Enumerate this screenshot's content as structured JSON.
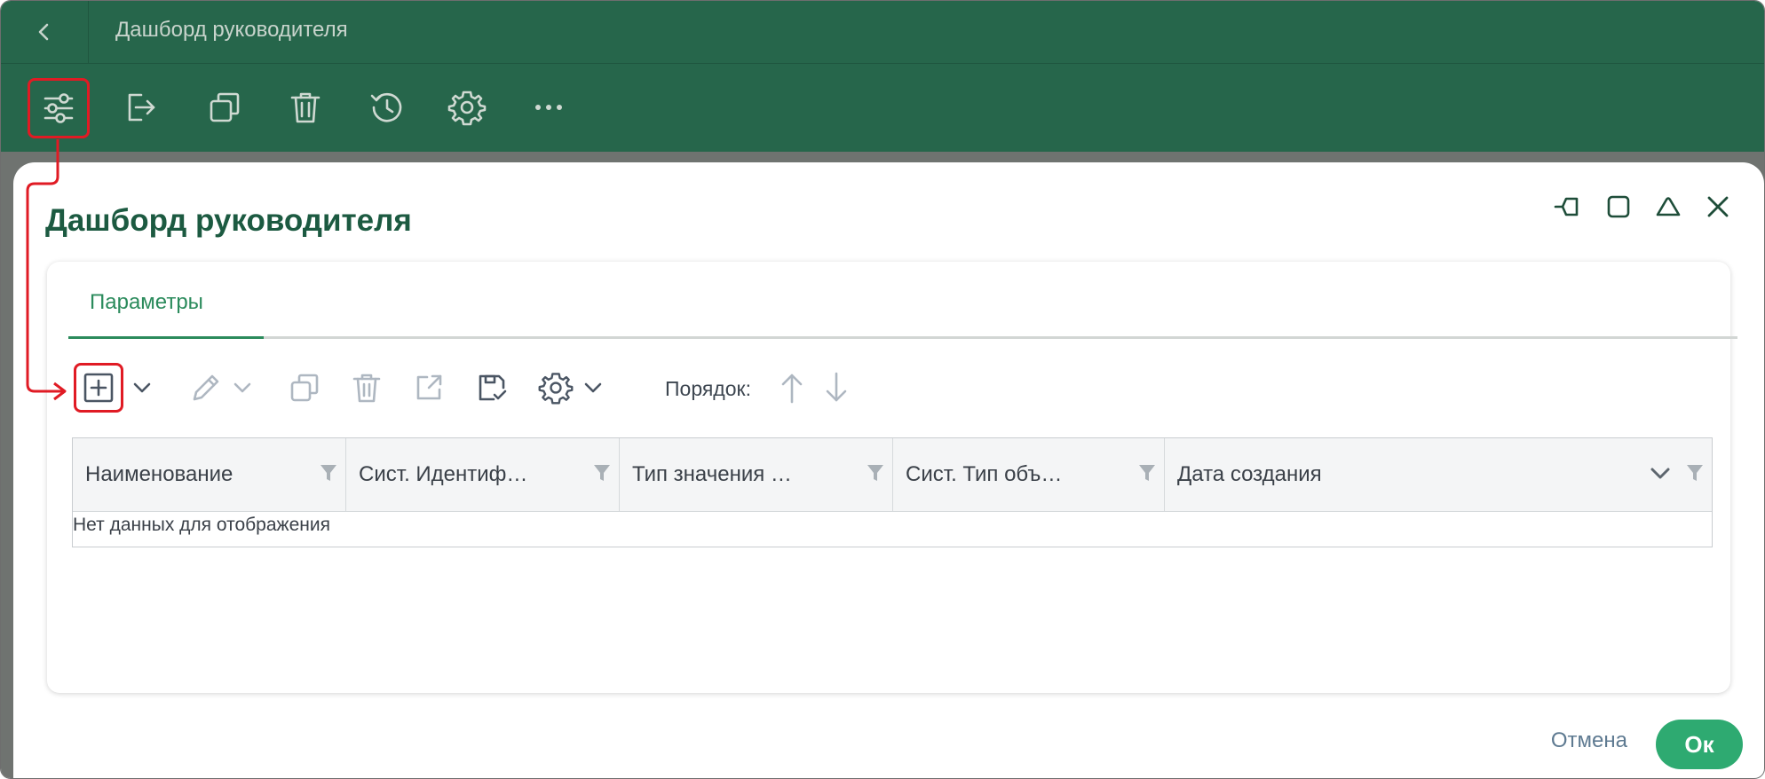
{
  "app": {
    "title": "Дашборд руководителя"
  },
  "toolbar": {
    "icons": [
      "sliders-icon",
      "exit-icon",
      "copy-icon",
      "trash-icon",
      "history-icon",
      "gear-icon",
      "more-icon"
    ]
  },
  "dialog": {
    "title": "Дашборд руководителя",
    "tabs": [
      {
        "label": "Параметры",
        "active": true
      }
    ],
    "grid_toolbar": {
      "order_label": "Порядок:"
    },
    "table": {
      "columns": [
        {
          "label": "Наименование"
        },
        {
          "label": "Сист. Идентиф…"
        },
        {
          "label": "Тип значения …"
        },
        {
          "label": "Сист. Тип объ…"
        },
        {
          "label": "Дата создания"
        }
      ],
      "empty_text": "Нет данных для отображения"
    },
    "footer": {
      "cancel_label": "Отмена",
      "ok_label": "Ок"
    }
  },
  "colors": {
    "header_green": "#26664b",
    "accent_green": "#2b8b5c",
    "ok_green": "#2eaa71",
    "highlight_red": "#e01b24",
    "title_green": "#1c5a41"
  }
}
